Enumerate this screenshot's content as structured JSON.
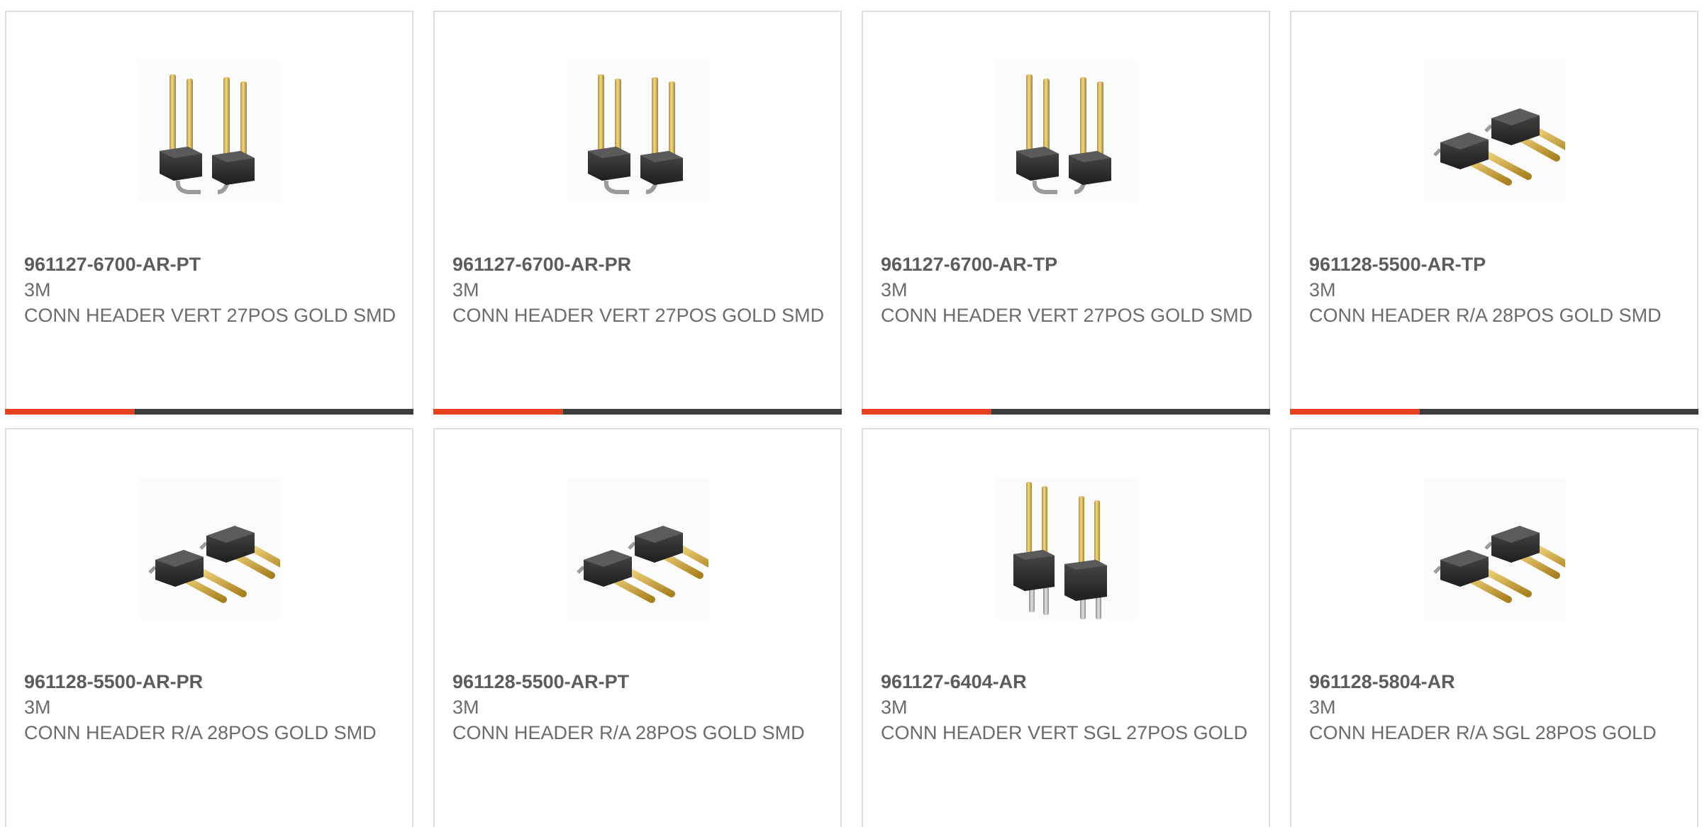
{
  "colors": {
    "accent": "#e8401c",
    "bar_dark": "#3c3c3c",
    "border": "#dedede",
    "text": "#6b6b6b"
  },
  "products": [
    {
      "part": "961127-6700-AR-PT",
      "manufacturer": "3M",
      "description": "CONN HEADER VERT 27POS GOLD SMD",
      "icon": "vertical-smd-header-icon"
    },
    {
      "part": "961127-6700-AR-PR",
      "manufacturer": "3M",
      "description": "CONN HEADER VERT 27POS GOLD SMD",
      "icon": "vertical-smd-header-icon"
    },
    {
      "part": "961127-6700-AR-TP",
      "manufacturer": "3M",
      "description": "CONN HEADER VERT 27POS GOLD SMD",
      "icon": "vertical-smd-header-icon"
    },
    {
      "part": "961128-5500-AR-TP",
      "manufacturer": "3M",
      "description": "CONN HEADER R/A 28POS GOLD SMD",
      "icon": "right-angle-header-icon"
    },
    {
      "part": "961128-5500-AR-PR",
      "manufacturer": "3M",
      "description": "CONN HEADER R/A 28POS GOLD SMD",
      "icon": "right-angle-header-icon"
    },
    {
      "part": "961128-5500-AR-PT",
      "manufacturer": "3M",
      "description": "CONN HEADER R/A 28POS GOLD SMD",
      "icon": "right-angle-header-icon"
    },
    {
      "part": "961127-6404-AR",
      "manufacturer": "3M",
      "description": "CONN HEADER VERT SGL 27POS GOLD",
      "icon": "vertical-through-hole-header-icon"
    },
    {
      "part": "961128-5804-AR",
      "manufacturer": "3M",
      "description": "CONN HEADER R/A SGL 28POS GOLD",
      "icon": "right-angle-header-icon"
    }
  ]
}
